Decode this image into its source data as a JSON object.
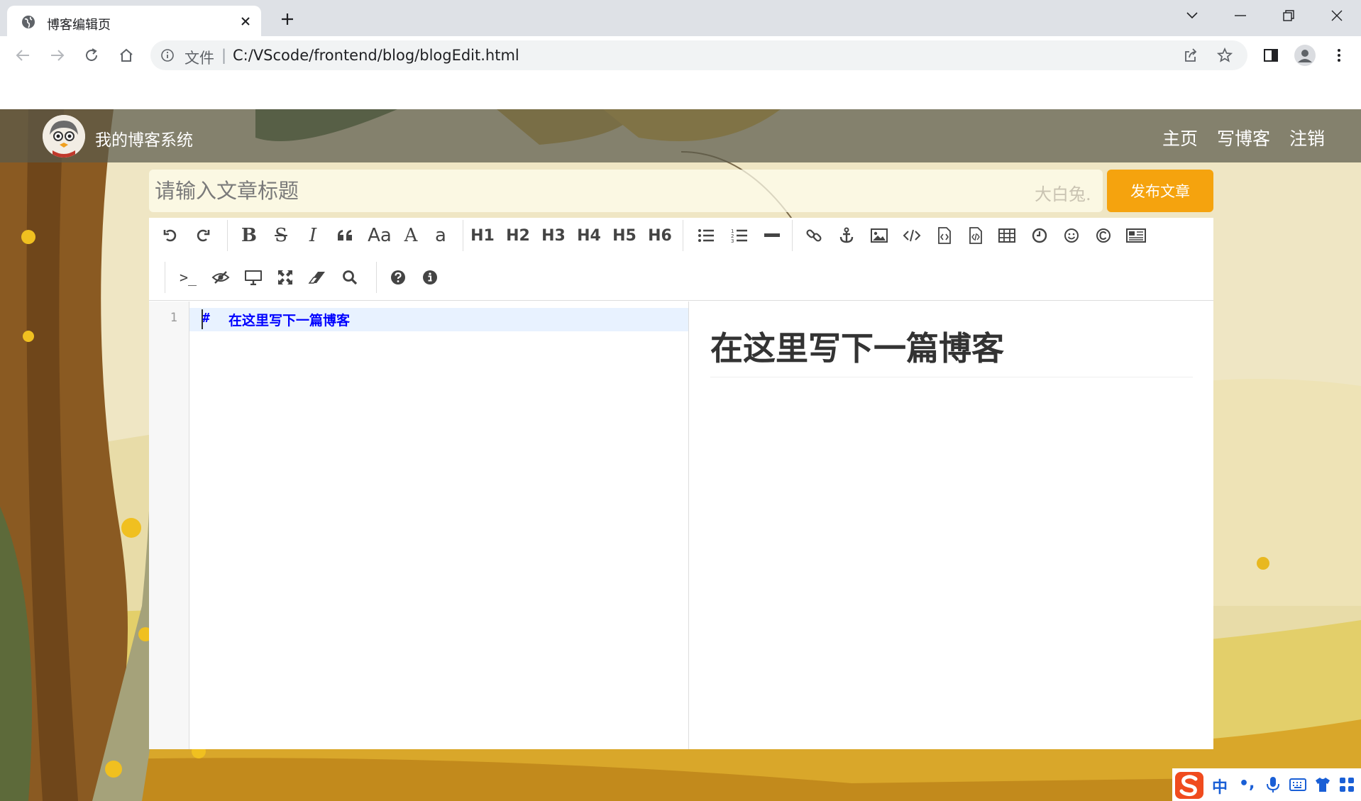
{
  "browser": {
    "tab_title": "博客编辑页",
    "new_tab_label": "+",
    "address_scheme": "文件",
    "address_separator": "|",
    "address_url": "C:/VScode/frontend/blog/blogEdit.html"
  },
  "site": {
    "title": "我的博客系统",
    "nav": [
      "主页",
      "写博客",
      "注销"
    ]
  },
  "editor_page": {
    "title_placeholder": "请输入文章标题",
    "watermark": "大白兔.",
    "publish_label": "发布文章"
  },
  "toolbar": {
    "headings": [
      "H1",
      "H2",
      "H3",
      "H4",
      "H5",
      "H6"
    ],
    "case_labels": [
      "Aa",
      "A",
      "a"
    ],
    "terminal_label": ">_"
  },
  "code": {
    "line_number": "1",
    "hash": "#",
    "text": "在这里写下一篇博客"
  },
  "preview": {
    "heading": "在这里写下一篇博客"
  },
  "ime": {
    "mode": "中",
    "punct": "•,"
  },
  "colors": {
    "accent": "#f5a30e",
    "code_text": "#0000ff"
  }
}
